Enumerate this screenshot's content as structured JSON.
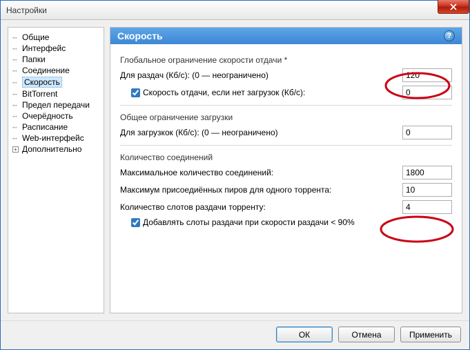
{
  "window": {
    "title": "Настройки"
  },
  "sidebar": {
    "items": [
      {
        "label": "Общие"
      },
      {
        "label": "Интерфейс"
      },
      {
        "label": "Папки"
      },
      {
        "label": "Соединение"
      },
      {
        "label": "Скорость",
        "selected": true
      },
      {
        "label": "BitTorrent"
      },
      {
        "label": "Предел передачи"
      },
      {
        "label": "Очерёдность"
      },
      {
        "label": "Расписание"
      },
      {
        "label": "Web-интерфейс"
      },
      {
        "label": "Дополнительно",
        "expandable": true
      }
    ]
  },
  "header": {
    "title": "Скорость"
  },
  "groups": {
    "upload": {
      "title": "Глобальное ограничение скорости отдачи *",
      "rate_label": "Для раздач (Кб/с): (0 — неограничено)",
      "rate_value": "120",
      "alt_checked": true,
      "alt_label": "Скорость отдачи, если нет загрузок (Кб/с):",
      "alt_value": "0"
    },
    "download": {
      "title": "Общее ограничение загрузки",
      "rate_label": "Для загрузкок (Кб/с): (0 — неограничено)",
      "rate_value": "0"
    },
    "connections": {
      "title": "Количество соединений",
      "max_conn_label": "Максимальное количество соединений:",
      "max_conn_value": "1800",
      "max_peers_label": "Максимум присоедиённых пиров для одного торрента:",
      "max_peers_value": "10",
      "slots_label": "Количество слотов раздачи торренту:",
      "slots_value": "4",
      "add_slots_checked": true,
      "add_slots_label": "Добавлять слоты раздачи при скорости раздачи < 90%"
    }
  },
  "buttons": {
    "ok": "ОК",
    "cancel": "Отмена",
    "apply": "Применить"
  }
}
